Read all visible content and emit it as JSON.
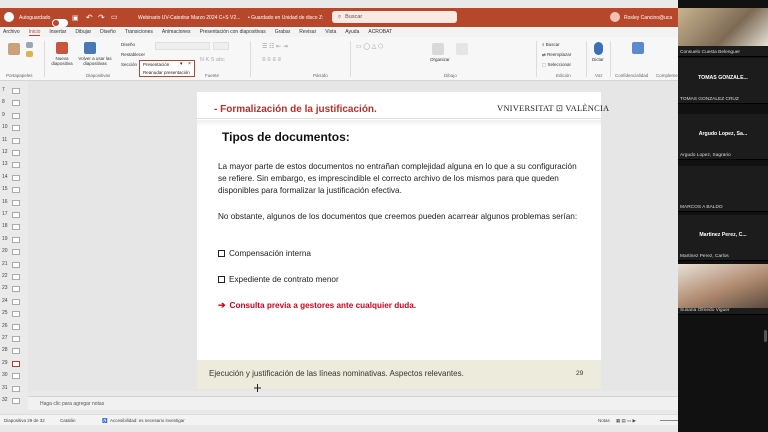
{
  "titlebar": {
    "autosave_label": "Autoguardado",
    "doc_title": "Webinario UV-Catedrar Marzo 2024 C+S V2...",
    "save_state": "• Guardado en Unidad de disco Z:",
    "search_placeholder": "Buscar",
    "user_name": "Rosley Cancino@uca"
  },
  "ribbon": {
    "tabs": [
      "Archivo",
      "Inicio",
      "Insertar",
      "Dibujar",
      "Diseño",
      "Transiciones",
      "Animaciones",
      "Presentación con diapositivas",
      "Grabar",
      "Revisar",
      "Vista",
      "Ayuda",
      "ACROBAT"
    ],
    "active_tab": "Inicio",
    "groups": [
      "Portapapeles",
      "Diapositivas",
      "Fuente",
      "Párrafo",
      "Dibujo",
      "Edición",
      "Voz",
      "Confidencialidad",
      "Complementos"
    ],
    "buttons": {
      "new_slide": "Nueva diapositiva",
      "reuse": "Volver a usar las diapositivas",
      "layout": "Diseño",
      "reset": "Restablecer",
      "section": "Sección",
      "arrange": "Organizar",
      "find": "Buscar",
      "replace": "Reemplazar",
      "select": "Seleccionar",
      "dictate": "Dictar",
      "sensitivity": "Confidencialidad",
      "addins": "Complementos",
      "dropdown_value": "Presentación",
      "dropdown_item": "Reanudar presentación"
    }
  },
  "thumbs": [
    "7",
    "8",
    "9",
    "10",
    "11",
    "12",
    "13",
    "14",
    "15",
    "16",
    "17",
    "18",
    "19",
    "20",
    "21",
    "22",
    "23",
    "24",
    "25",
    "26",
    "27",
    "28",
    "29",
    "30",
    "31",
    "32"
  ],
  "selected_thumb": "29",
  "slide": {
    "title": "- Formalización de la justificación.",
    "logo": "VNIVERSITAT ⊡ VALÈNCIA",
    "heading": "Tipos de documentos:",
    "paragraph1": "La mayor parte de estos documentos no entrañan complejidad alguna en lo que a su configuración se refiere. Sin embargo, es imprescindible el correcto archivo de los mismos para que queden disponibles para formalizar la justificación efectiva.",
    "paragraph2": "No obstante, algunos de los documentos que creemos pueden acarrear algunos problemas serían:",
    "bullets": [
      "Compensación interna",
      "Expediente de contrato menor"
    ],
    "warning": "Consulta previa a gestores ante cualquier duda.",
    "footer_text": "Ejecución y justificación de las líneas  nominativas. Aspectos relevantes.",
    "page_number": "29"
  },
  "notes_placeholder": "Haga clic para agregar notas",
  "status": {
    "slide_info": "Diapositiva 29 de 32",
    "language": "Catalán",
    "accessibility": "Accesibilidad: es necesario investigar",
    "notes": "Notas",
    "zoom": "100 %"
  },
  "participants": [
    {
      "name": "Consuelo Cuesta Belenguer",
      "initials": ""
    },
    {
      "name": "TOMAS GONZALEZ CRUZ",
      "initials": "TOMAS  GONZALE..."
    },
    {
      "name": "Argudo Lopez, Sagrario",
      "initials": "Argudo  Lopez,  Sa..."
    },
    {
      "name": "MARCOS A BALDO",
      "initials": ""
    },
    {
      "name": "Martinez Perez, Carlos",
      "initials": "Martinez  Perez,  C..."
    },
    {
      "name": "Susana Olmedo Viguer",
      "initials": ""
    }
  ],
  "colors": {
    "brand": "#b7472a",
    "title_red": "#b5312a",
    "warning_red": "#d0021b"
  }
}
